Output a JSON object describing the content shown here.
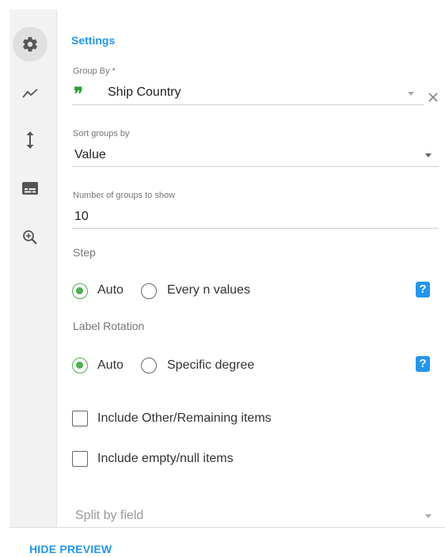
{
  "sidebar": {
    "items": [
      {
        "icon": "gear-icon",
        "active": true
      },
      {
        "icon": "line-chart-icon",
        "active": false
      },
      {
        "icon": "vertical-arrows-icon",
        "active": false
      },
      {
        "icon": "subtitles-icon",
        "active": false
      },
      {
        "icon": "zoom-in-icon",
        "active": false
      }
    ]
  },
  "settings": {
    "title": "Settings",
    "group_by": {
      "label": "Group By *",
      "value": "Ship Country",
      "icon": "quote-icon"
    },
    "sort_groups": {
      "label": "Sort groups by",
      "value": "Value"
    },
    "num_groups": {
      "label": "Number of groups to show",
      "value": "10"
    },
    "step": {
      "label": "Step",
      "options": [
        {
          "label": "Auto",
          "checked": true
        },
        {
          "label": "Every n values",
          "checked": false
        }
      ],
      "help": "?"
    },
    "label_rotation": {
      "label": "Label Rotation",
      "options": [
        {
          "label": "Auto",
          "checked": true
        },
        {
          "label": "Specific degree",
          "checked": false
        }
      ],
      "help": "?"
    },
    "include_other": {
      "label": "Include Other/Remaining items",
      "checked": false
    },
    "include_empty": {
      "label": "Include empty/null items",
      "checked": false
    },
    "split_by": {
      "placeholder": "Split by field"
    }
  },
  "footer": {
    "hide_preview": "HIDE PREVIEW"
  },
  "colors": {
    "accent": "#2196f3",
    "success": "#4caf50",
    "quote": "#2e9e3a"
  }
}
